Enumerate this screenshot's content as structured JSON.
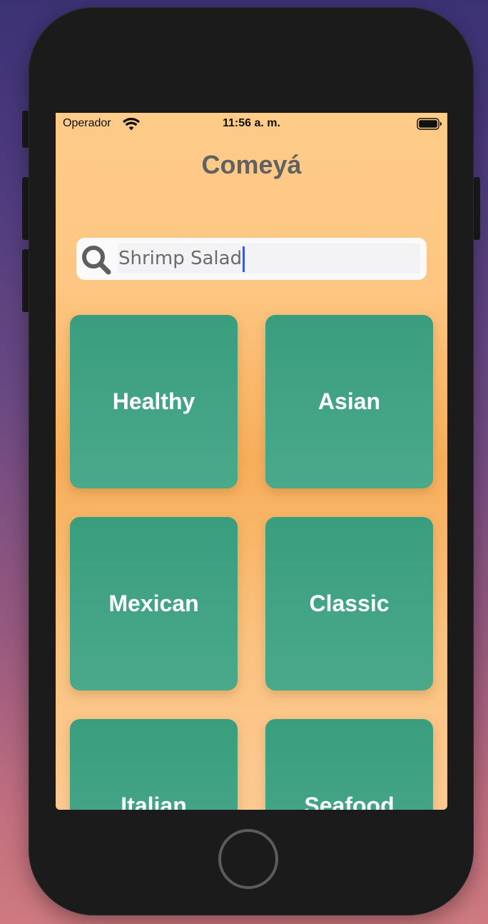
{
  "status_bar": {
    "carrier": "Operador",
    "time": "11:56 a. m.",
    "wifi_icon": "wifi-icon",
    "battery_icon": "battery-full-icon"
  },
  "app": {
    "title": "Comeyá"
  },
  "search": {
    "value": "Shrimp Salad",
    "icon": "search-icon"
  },
  "categories": [
    {
      "label": "Healthy"
    },
    {
      "label": "Asian"
    },
    {
      "label": "Mexican"
    },
    {
      "label": "Classic"
    },
    {
      "label": "Italian"
    },
    {
      "label": "Seafood"
    }
  ],
  "colors": {
    "background_top": "#fecb89",
    "background_mid": "#f7ae59",
    "card": "#399e7e",
    "card_text": "#ffffff",
    "title_text": "#616161",
    "caret": "#3a5be0"
  }
}
